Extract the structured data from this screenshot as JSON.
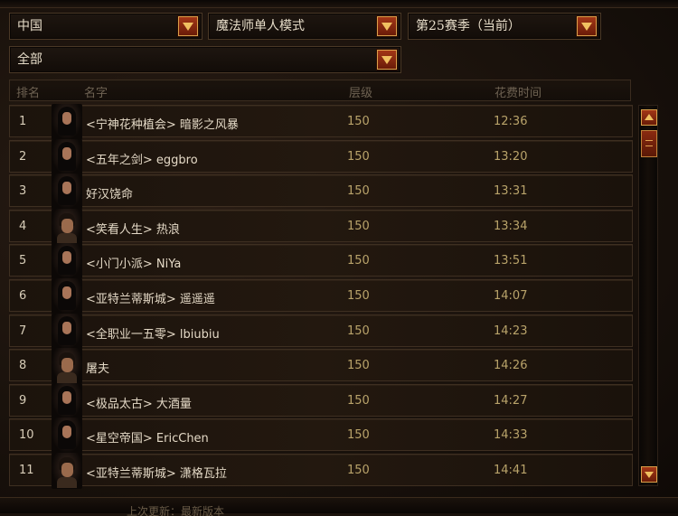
{
  "filters": {
    "region": "中国",
    "mode": "魔法师单人模式",
    "season": "第25赛季（当前）",
    "category": "全部"
  },
  "table": {
    "headers": {
      "rank": "排名",
      "name": "名字",
      "level": "层级",
      "time": "花费时间"
    },
    "rows": [
      {
        "rank": "1",
        "name": "<宁神花种植会> 暗影之风暴",
        "level": "150",
        "time": "12:36",
        "portrait": "female"
      },
      {
        "rank": "2",
        "name": "<五年之剑> eggbro",
        "level": "150",
        "time": "13:20",
        "portrait": "female"
      },
      {
        "rank": "3",
        "name": "好汉饶命",
        "level": "150",
        "time": "13:31",
        "portrait": "female"
      },
      {
        "rank": "4",
        "name": "<笑看人生> 热浪",
        "level": "150",
        "time": "13:34",
        "portrait": "male"
      },
      {
        "rank": "5",
        "name": "<小门小派> NiYa",
        "level": "150",
        "time": "13:51",
        "portrait": "female"
      },
      {
        "rank": "6",
        "name": "<亚特兰蒂斯城> 遥遥遥",
        "level": "150",
        "time": "14:07",
        "portrait": "female"
      },
      {
        "rank": "7",
        "name": "<全职业一五零> lbiubiu",
        "level": "150",
        "time": "14:23",
        "portrait": "female"
      },
      {
        "rank": "8",
        "name": "屠夫",
        "level": "150",
        "time": "14:26",
        "portrait": "male"
      },
      {
        "rank": "9",
        "name": "<极品太古> 大酒量",
        "level": "150",
        "time": "14:27",
        "portrait": "female"
      },
      {
        "rank": "10",
        "name": "<星空帝国> EricChen",
        "level": "150",
        "time": "14:33",
        "portrait": "female"
      },
      {
        "rank": "11",
        "name": "<亚特兰蒂斯城> 潇格瓦拉",
        "level": "150",
        "time": "14:41",
        "portrait": "male"
      }
    ]
  },
  "footer": {
    "text": "上次更新：最新版本"
  },
  "icons": {
    "dropdown_arrow": "chevron-down-icon",
    "scroll_up": "arrow-up-icon",
    "scroll_down": "arrow-down-icon"
  },
  "colors": {
    "accent": "#a23616",
    "accent_border": "#d9a04a",
    "value_text": "#b9a36a"
  }
}
